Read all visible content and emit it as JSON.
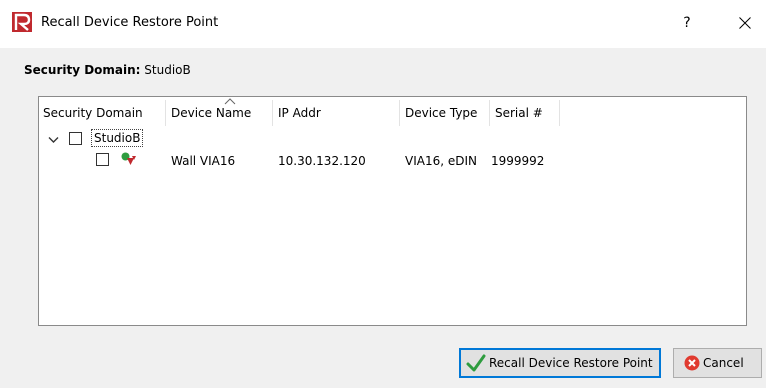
{
  "window": {
    "title": "Recall Device Restore Point",
    "help_label": "?",
    "close_label": "✕"
  },
  "security_domain": {
    "label": "Security Domain:",
    "value": "StudioB"
  },
  "tree": {
    "columns": [
      "Security Domain",
      "Device Name",
      "IP Addr",
      "Device Type",
      "Serial #"
    ],
    "group": {
      "name": "StudioB",
      "checked": false,
      "expanded": true
    },
    "devices": [
      {
        "device_name": "Wall VIA16",
        "ip_addr": "10.30.132.120",
        "device_type": "VIA16, eDIN",
        "serial": "1999992",
        "checked": false
      }
    ]
  },
  "buttons": {
    "recall_label": "Recall Device Restore Point",
    "cancel_label": "Cancel"
  },
  "colors": {
    "accent": "#0078d7",
    "brand": "#c0292e",
    "check_green": "#2e9c3f",
    "cancel_red": "#e03a2f"
  },
  "icons": {
    "app": "app-logo-icon",
    "close": "close-icon",
    "sort": "sort-ascending-icon",
    "expand": "chevron-down-icon",
    "device": "device-status-icon",
    "recall": "checkmark-icon",
    "cancel": "cancel-icon"
  }
}
